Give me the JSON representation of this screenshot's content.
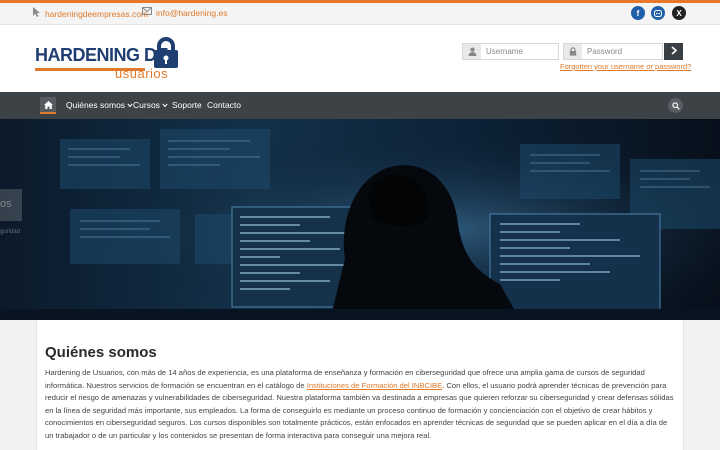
{
  "topbar": {
    "website": "hardeningdeempresas.com",
    "email": "info@hardening.es",
    "social": [
      {
        "name": "facebook",
        "glyph": "f"
      },
      {
        "name": "discord",
        "glyph": "d"
      },
      {
        "name": "x",
        "glyph": "X"
      }
    ]
  },
  "header": {
    "logo_word1": "HARDENING DE",
    "logo_word2": "usuarios",
    "username_placeholder": "Username",
    "password_placeholder": "Password",
    "forgot_link": "Forgotten your username or password?"
  },
  "nav": {
    "items": [
      "Quiénes somos",
      "Cursos",
      "Soporte",
      "Contacto"
    ]
  },
  "hero": {
    "side_label": "os",
    "side_sub": "guridad"
  },
  "content": {
    "title": "Quiénes somos",
    "paragraph_part1": "Hardening de Usuarios, con más de 14 años de experiencia, es una plataforma de enseñanza y formación en ciberseguridad que ofrece una amplia gama de cursos de seguridad informática. Nuestros servicios de formación se encuentran en el catálogo de ",
    "paragraph_link": "Instituciones de Formación del INBCIBE",
    "paragraph_part2": ". Con ellos, el usuario podrá aprender técnicas de prevención para reducir el riesgo de amenazas y vulnerabilidades de ciberseguridad. Nuestra plataforma también va destinada a empresas que quieren reforzar su ciberseguridad y crear defensas sólidas en la línea de seguridad más importante, sus empleados. La forma de conseguirlo es mediante un proceso continuo de formación y concienciación con el objetivo de crear hábitos y conocimientos en ciberseguridad seguros. Los cursos disponibles son totalmente prácticos, están enfocados en aprender técnicas de seguridad que se pueden aplicar en el día a día de un trabajador o de un particular y los contenidos se presentan de forma interactiva para conseguir una mejora real."
  },
  "colors": {
    "accent": "#e07a2a",
    "navy": "#1f3f73",
    "nav_bg": "#3d4247"
  }
}
